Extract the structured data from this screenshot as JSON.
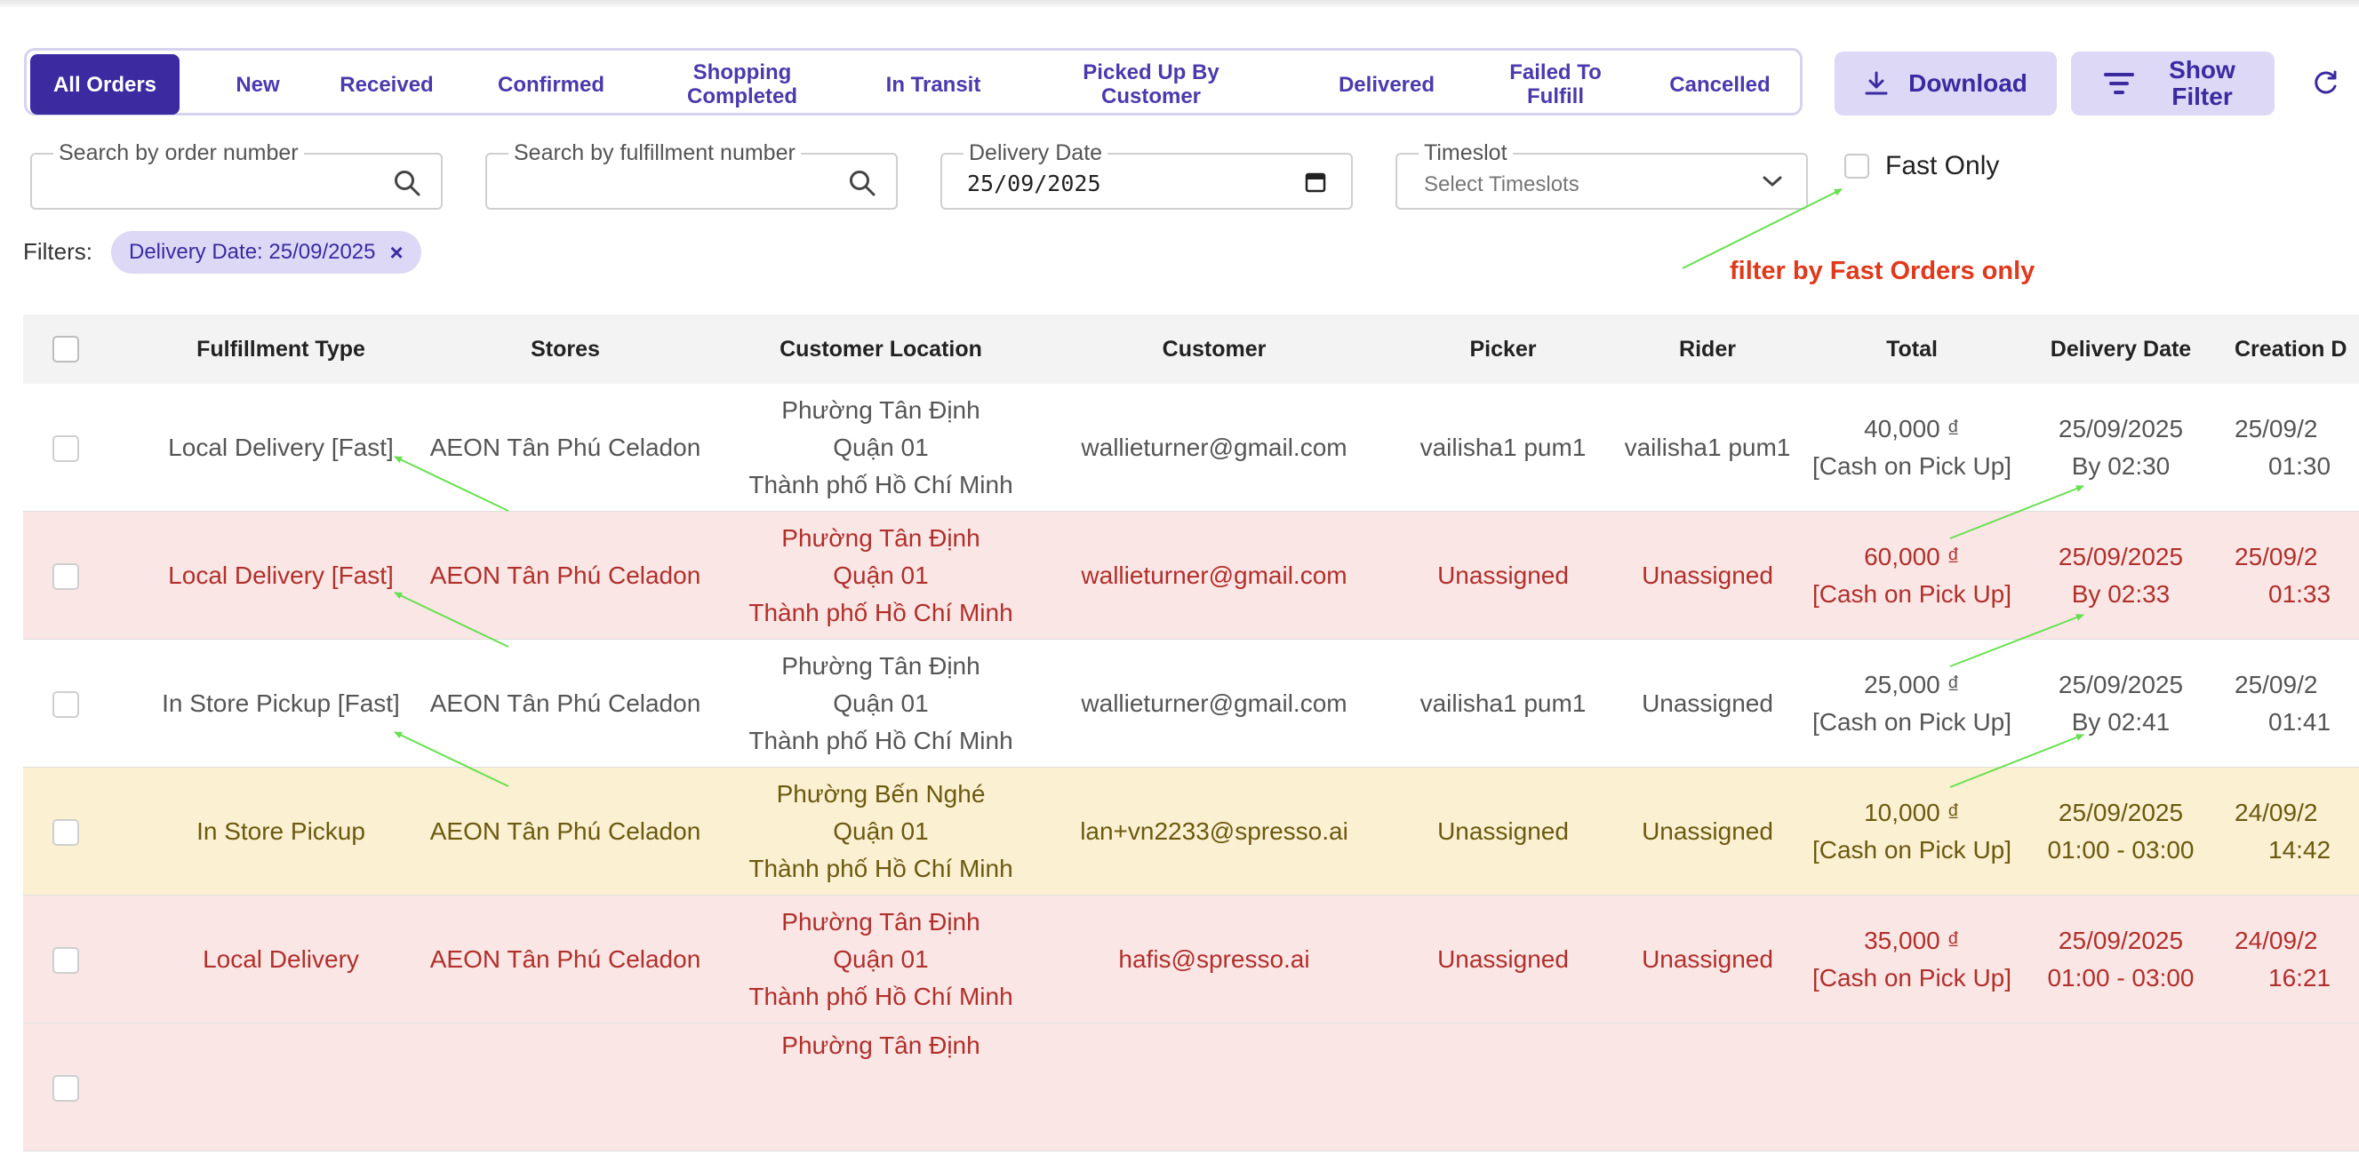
{
  "status_tabs": [
    {
      "label": "All Orders",
      "active": true
    },
    {
      "label": "New"
    },
    {
      "label": "Received"
    },
    {
      "label": "Confirmed"
    },
    {
      "label": "Shopping Completed"
    },
    {
      "label": "In Transit"
    },
    {
      "label": "Picked Up By Customer"
    },
    {
      "label": "Delivered"
    },
    {
      "label": "Failed To Fulfill"
    },
    {
      "label": "Cancelled"
    }
  ],
  "toolbar": {
    "download_label": "Download",
    "show_filter_label": "Show Filter",
    "download_icon": "download-icon",
    "filter_icon": "filter-icon",
    "refresh_icon": "refresh-icon"
  },
  "search": {
    "order_number_label": "Search by order number",
    "fulfillment_number_label": "Search by fulfillment number",
    "delivery_date_label": "Delivery Date",
    "delivery_date_value": "25/09/2025",
    "timeslot_label": "Timeslot",
    "timeslot_placeholder": "Select Timeslots",
    "fast_only_label": "Fast Only",
    "fast_only_checked": false
  },
  "filters": {
    "label": "Filters:",
    "chips": [
      {
        "label": "Delivery Date: 25/09/2025",
        "remove": "×"
      }
    ]
  },
  "annotation": {
    "text": "filter by Fast Orders only",
    "color": "#e0391b",
    "arrow_color": "#66e04d"
  },
  "table": {
    "columns": [
      "Fulfillment Type",
      "Stores",
      "Customer Location",
      "Customer",
      "Picker",
      "Rider",
      "Total",
      "Delivery Date",
      "Creation D"
    ],
    "rows": [
      {
        "tone": "default",
        "fulfillment_type": "Local Delivery [Fast]",
        "store": "AEON Tân Phú Celadon",
        "location": [
          "Phường Tân Định",
          "Quận 01",
          "Thành phố Hồ Chí Minh"
        ],
        "customer": "wallieturner@gmail.com",
        "picker": "vailisha1 pum1",
        "rider": "vailisha1 pum1",
        "total": [
          "40,000 ₫",
          "[Cash on Pick Up]"
        ],
        "delivery_date": [
          "25/09/2025",
          "By 02:30"
        ],
        "creation": [
          "25/09/2",
          "01:30"
        ]
      },
      {
        "tone": "red",
        "fulfillment_type": "Local Delivery [Fast]",
        "store": "AEON Tân Phú Celadon",
        "location": [
          "Phường Tân Định",
          "Quận 01",
          "Thành phố Hồ Chí Minh"
        ],
        "customer": "wallieturner@gmail.com",
        "picker": "Unassigned",
        "rider": "Unassigned",
        "total": [
          "60,000 ₫",
          "[Cash on Pick Up]"
        ],
        "delivery_date": [
          "25/09/2025",
          "By 02:33"
        ],
        "creation": [
          "25/09/2",
          "01:33"
        ]
      },
      {
        "tone": "default",
        "fulfillment_type": "In Store Pickup [Fast]",
        "store": "AEON Tân Phú Celadon",
        "location": [
          "Phường Tân Định",
          "Quận 01",
          "Thành phố Hồ Chí Minh"
        ],
        "customer": "wallieturner@gmail.com",
        "picker": "vailisha1 pum1",
        "rider": "Unassigned",
        "total": [
          "25,000 ₫",
          "[Cash on Pick Up]"
        ],
        "delivery_date": [
          "25/09/2025",
          "By 02:41"
        ],
        "creation": [
          "25/09/2",
          "01:41"
        ]
      },
      {
        "tone": "yellow",
        "fulfillment_type": "In Store Pickup",
        "store": "AEON Tân Phú Celadon",
        "location": [
          "Phường Bến Nghé",
          "Quận 01",
          "Thành phố Hồ Chí Minh"
        ],
        "customer": "lan+vn2233@spresso.ai",
        "picker": "Unassigned",
        "rider": "Unassigned",
        "total": [
          "10,000 ₫",
          "[Cash on Pick Up]"
        ],
        "delivery_date": [
          "25/09/2025",
          "01:00 - 03:00"
        ],
        "creation": [
          "24/09/2",
          "14:42"
        ]
      },
      {
        "tone": "red",
        "fulfillment_type": "Local Delivery",
        "store": "AEON Tân Phú Celadon",
        "location": [
          "Phường Tân Định",
          "Quận 01",
          "Thành phố Hồ Chí Minh"
        ],
        "customer": "hafis@spresso.ai",
        "picker": "Unassigned",
        "rider": "Unassigned",
        "total": [
          "35,000 ₫",
          "[Cash on Pick Up]"
        ],
        "delivery_date": [
          "25/09/2025",
          "01:00 - 03:00"
        ],
        "creation": [
          "24/09/2",
          "16:21"
        ]
      },
      {
        "tone": "red",
        "fulfillment_type": "",
        "store": "",
        "location": [
          "Phường Tân Định"
        ],
        "customer": "",
        "picker": "",
        "rider": "",
        "total": [],
        "delivery_date": [],
        "creation": []
      }
    ]
  },
  "colors": {
    "accent": "#3b2aa0",
    "accent_light": "#dcd8f6",
    "row_red_bg": "#fbe6e6",
    "row_red_text": "#b0302b",
    "row_yellow_bg": "#fbf0d1",
    "row_yellow_text": "#6b5a10",
    "row_default_text": "#555555"
  }
}
